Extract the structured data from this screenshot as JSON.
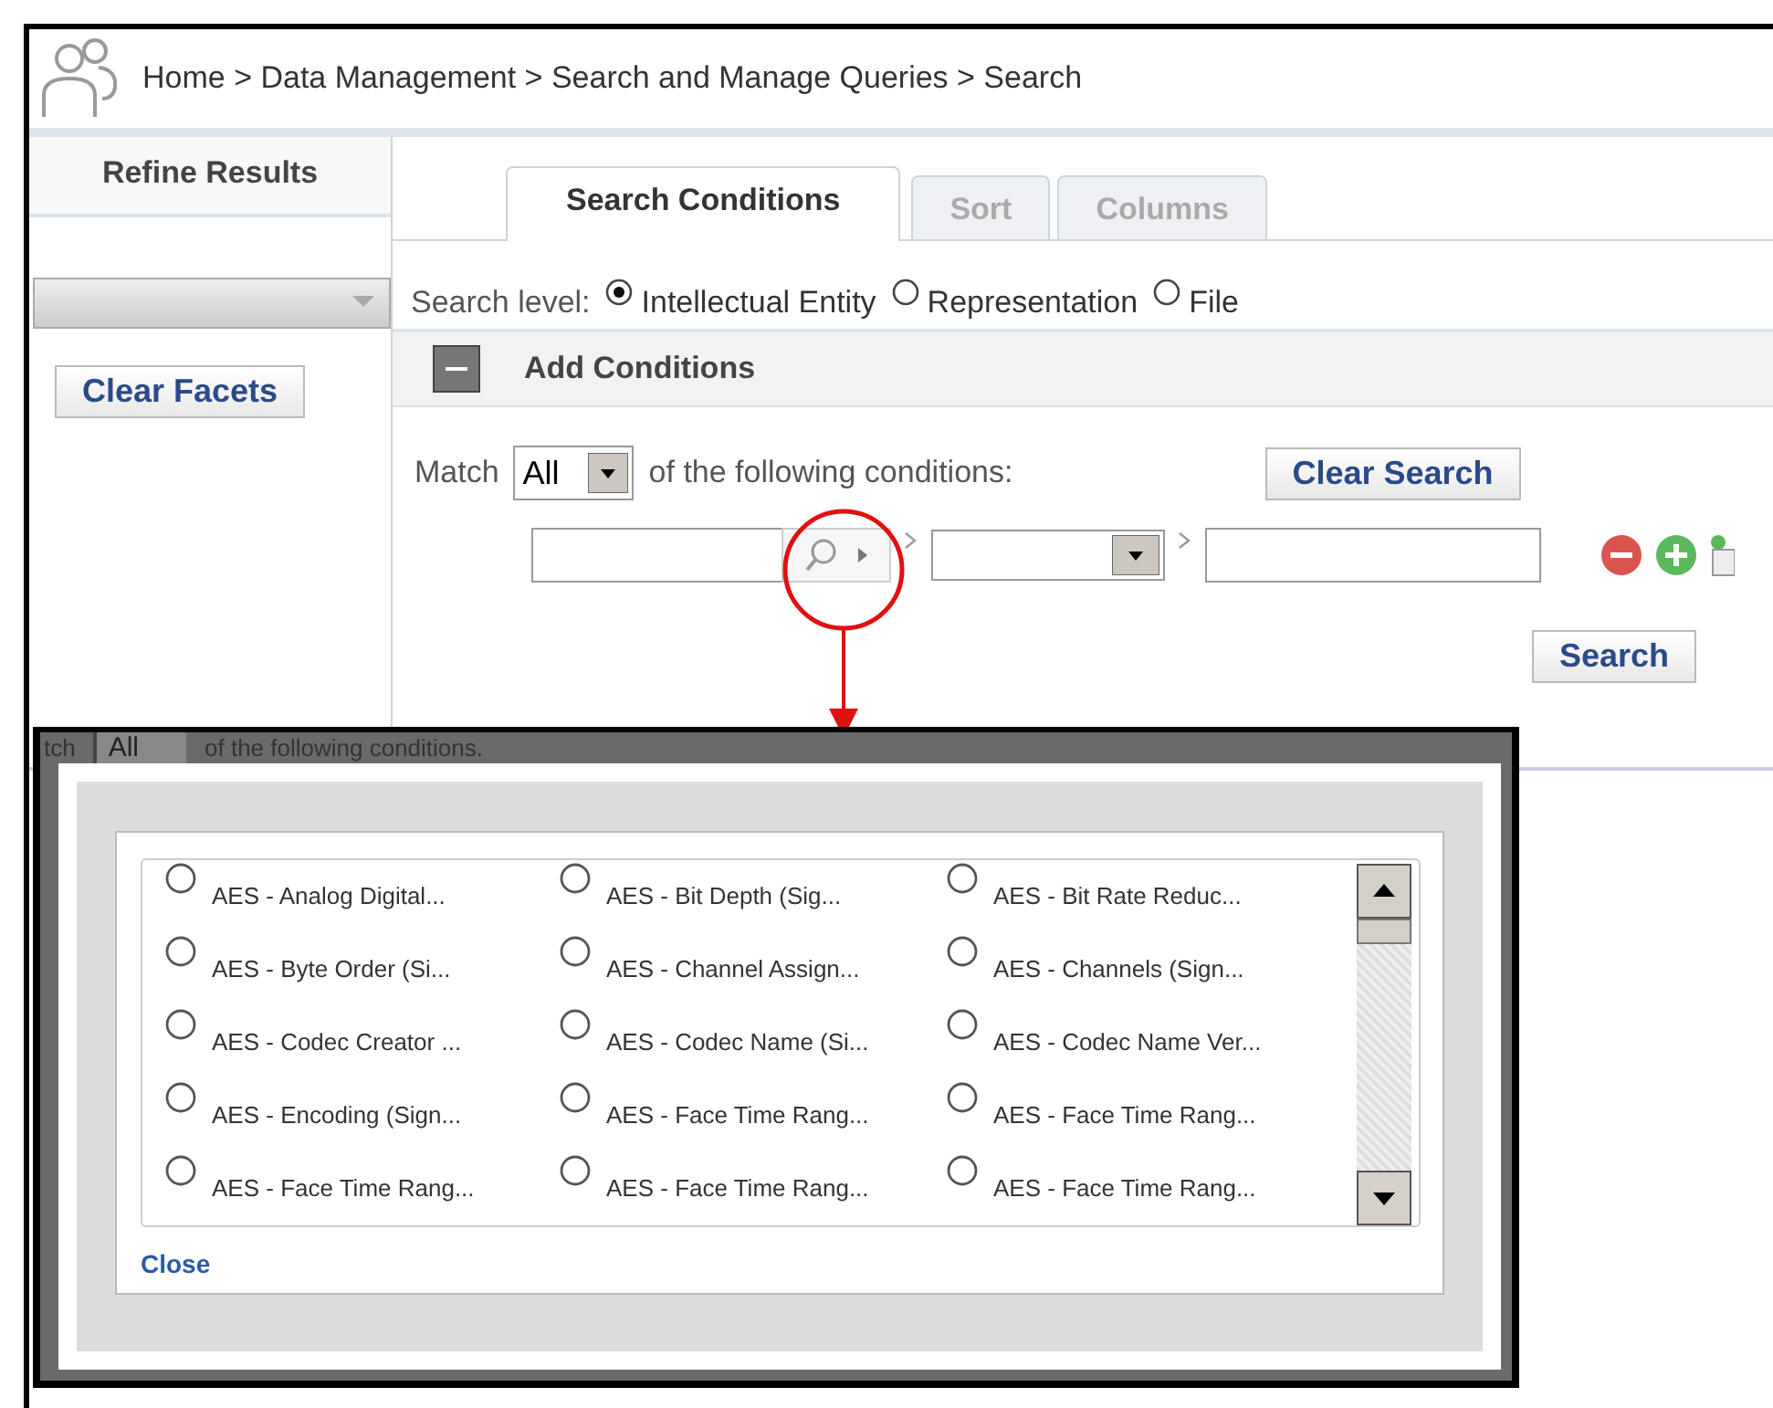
{
  "header": {
    "breadcrumb": "Home > Data Management > Search and Manage Queries > Search"
  },
  "sidebar": {
    "title": "Refine Results",
    "button": "Clear Facets"
  },
  "tabs": [
    {
      "label": "Search Conditions",
      "selected": true
    },
    {
      "label": "Sort",
      "selected": false
    },
    {
      "label": "Columns",
      "selected": false
    }
  ],
  "search_level": {
    "label": "Search level:",
    "options": [
      {
        "label": "Intellectual Entity",
        "selected": true
      },
      {
        "label": "Representation",
        "selected": false
      },
      {
        "label": "File",
        "selected": false
      }
    ]
  },
  "conditions": {
    "title": "Add Conditions",
    "expanded": true,
    "match_label": "Match",
    "match_value": "All",
    "match_suffix": "of the following conditions:",
    "clear_button": "Clear Search",
    "search_button": "Search"
  },
  "picker": {
    "behind": {
      "label_end": "tch",
      "select_value": "All",
      "suffix": "of the following conditions."
    },
    "options": [
      {
        "label": "AES - Analog Digital...",
        "selected": false
      },
      {
        "label": "AES - Bit Depth (Sig...",
        "selected": false
      },
      {
        "label": "AES - Bit Rate Reduc...",
        "selected": false
      },
      {
        "label": "AES - Byte Order (Si...",
        "selected": false
      },
      {
        "label": "AES - Channel Assign...",
        "selected": false
      },
      {
        "label": "AES - Channels (Sign...",
        "selected": false
      },
      {
        "label": "AES - Codec Creator ...",
        "selected": false
      },
      {
        "label": "AES - Codec Name (Si...",
        "selected": false
      },
      {
        "label": "AES - Codec Name Ver...",
        "selected": false
      },
      {
        "label": "AES - Encoding (Sign...",
        "selected": false
      },
      {
        "label": "AES - Face Time Rang...",
        "selected": false
      },
      {
        "label": "AES - Face Time Rang...",
        "selected": false
      },
      {
        "label": "AES - Face Time Rang...",
        "selected": false
      },
      {
        "label": "AES - Face Time Rang...",
        "selected": false
      },
      {
        "label": "AES - Face Time Rang...",
        "selected": false
      }
    ],
    "close": "Close"
  }
}
